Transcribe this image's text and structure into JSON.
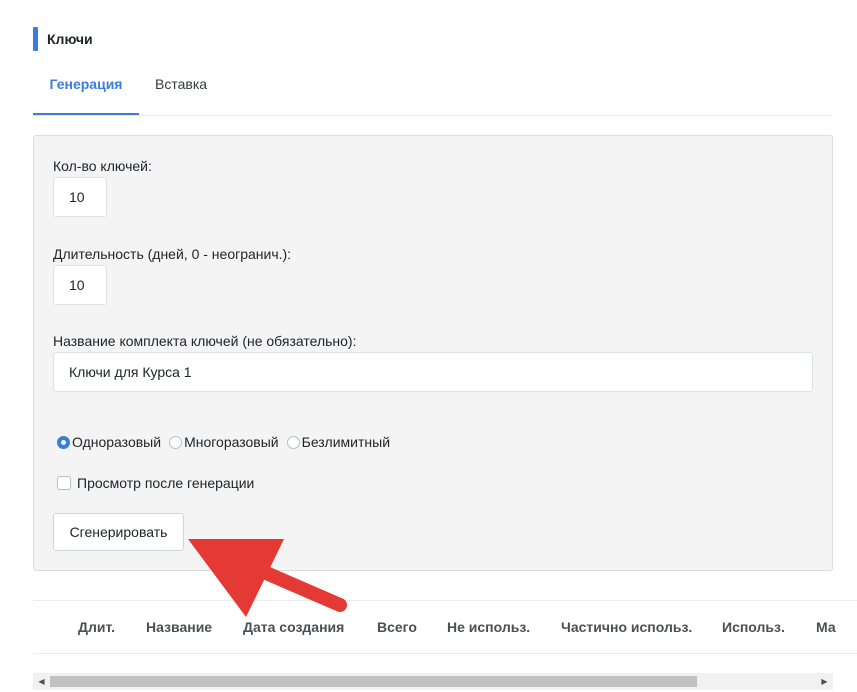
{
  "section": {
    "title": "Ключи"
  },
  "tabs": [
    {
      "label": "Генерация",
      "active": true
    },
    {
      "label": "Вставка",
      "active": false
    }
  ],
  "form": {
    "count_label": "Кол-во ключей:",
    "count_value": "10",
    "duration_label": "Длительность (дней, 0 - неогранич.):",
    "duration_value": "10",
    "name_label": "Название комплекта ключей (не обязательно):",
    "name_value": "Ключи для Курса 1",
    "radios": [
      {
        "label": "Одноразовый",
        "checked": true
      },
      {
        "label": "Многоразовый",
        "checked": false
      },
      {
        "label": "Безлимитный",
        "checked": false
      }
    ],
    "preview_label": "Просмотр после генерации",
    "preview_checked": false,
    "generate_label": "Сгенерировать"
  },
  "table": {
    "columns": [
      "Длит.",
      "Название",
      "Дата создания",
      "Всего",
      "Не использ.",
      "Частично использ.",
      "Использ.",
      "Ма"
    ]
  },
  "colors": {
    "accent": "#3b7ddd",
    "arrow": "#e53935"
  }
}
